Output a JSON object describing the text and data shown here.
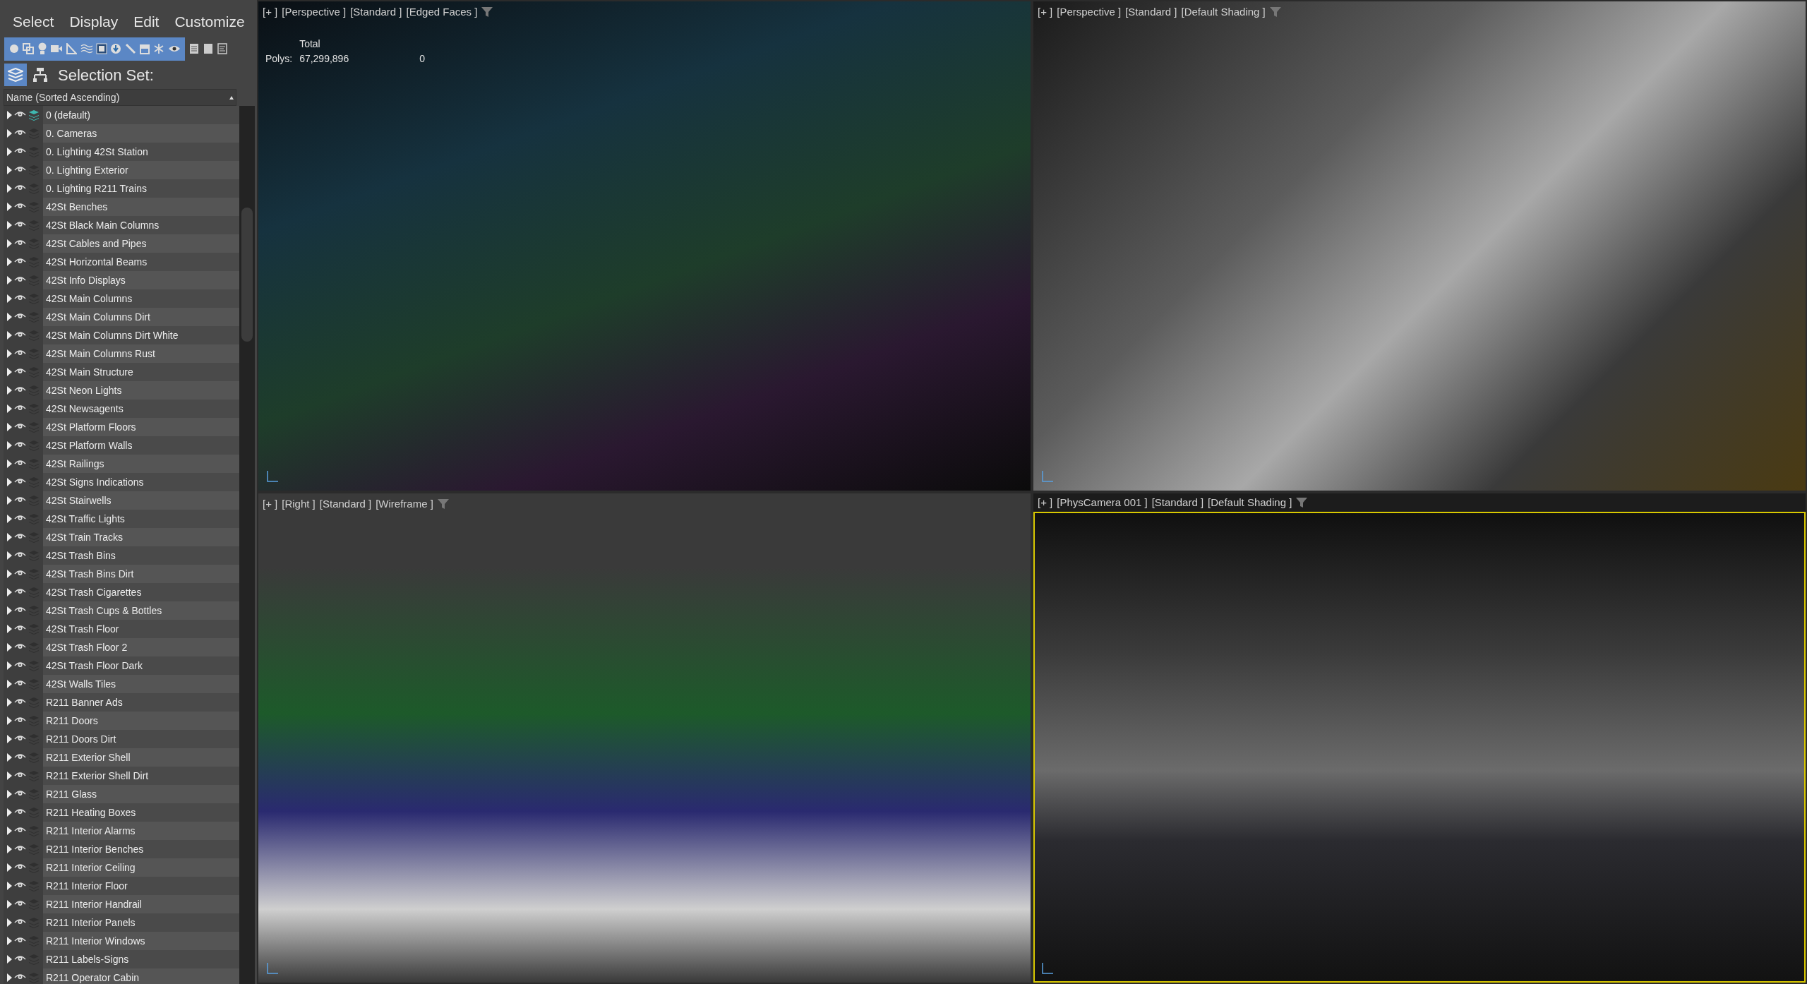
{
  "menu": [
    "Select",
    "Display",
    "Edit",
    "Customize"
  ],
  "selection_set": {
    "label": "Selection Set:"
  },
  "column_header": "Name (Sorted Ascending)",
  "layers": [
    {
      "name": "0 (default)",
      "visible": true,
      "current": true
    },
    {
      "name": "0. Cameras",
      "visible": true,
      "current": false
    },
    {
      "name": "0. Lighting 42St Station",
      "visible": true,
      "current": false
    },
    {
      "name": "0. Lighting Exterior",
      "visible": true,
      "current": false
    },
    {
      "name": "0. Lighting R211 Trains",
      "visible": true,
      "current": false
    },
    {
      "name": "42St Benches",
      "visible": true,
      "current": false
    },
    {
      "name": "42St Black Main Columns",
      "visible": true,
      "current": false
    },
    {
      "name": "42St Cables and Pipes",
      "visible": true,
      "current": false
    },
    {
      "name": "42St Horizontal Beams",
      "visible": true,
      "current": false
    },
    {
      "name": "42St Info Displays",
      "visible": true,
      "current": false
    },
    {
      "name": "42St Main Columns",
      "visible": true,
      "current": false
    },
    {
      "name": "42St Main Columns Dirt",
      "visible": true,
      "current": false
    },
    {
      "name": "42St Main Columns Dirt White",
      "visible": true,
      "current": false
    },
    {
      "name": "42St Main Columns Rust",
      "visible": true,
      "current": false
    },
    {
      "name": "42St Main Structure",
      "visible": true,
      "current": false
    },
    {
      "name": "42St Neon Lights",
      "visible": true,
      "current": false
    },
    {
      "name": "42St Newsagents",
      "visible": true,
      "current": false
    },
    {
      "name": "42St Platform Floors",
      "visible": true,
      "current": false
    },
    {
      "name": "42St Platform Walls",
      "visible": true,
      "current": false
    },
    {
      "name": "42St Railings",
      "visible": true,
      "current": false
    },
    {
      "name": "42St Signs Indications",
      "visible": true,
      "current": false
    },
    {
      "name": "42St Stairwells",
      "visible": true,
      "current": false
    },
    {
      "name": "42St Traffic Lights",
      "visible": true,
      "current": false
    },
    {
      "name": "42St Train Tracks",
      "visible": true,
      "current": false
    },
    {
      "name": "42St Trash Bins",
      "visible": true,
      "current": false
    },
    {
      "name": "42St Trash Bins Dirt",
      "visible": true,
      "current": false
    },
    {
      "name": "42St Trash Cigarettes",
      "visible": true,
      "current": false
    },
    {
      "name": "42St Trash Cups & Bottles",
      "visible": true,
      "current": false
    },
    {
      "name": "42St Trash Floor",
      "visible": true,
      "current": false
    },
    {
      "name": "42St Trash Floor 2",
      "visible": true,
      "current": false
    },
    {
      "name": "42St Trash Floor Dark",
      "visible": true,
      "current": false
    },
    {
      "name": "42St Walls Tiles",
      "visible": true,
      "current": false
    },
    {
      "name": "R211 Banner Ads",
      "visible": true,
      "current": false
    },
    {
      "name": "R211 Doors",
      "visible": true,
      "current": false
    },
    {
      "name": "R211 Doors Dirt",
      "visible": true,
      "current": false
    },
    {
      "name": "R211 Exterior Shell",
      "visible": true,
      "current": false
    },
    {
      "name": "R211 Exterior Shell Dirt",
      "visible": true,
      "current": false
    },
    {
      "name": "R211 Glass",
      "visible": true,
      "current": false
    },
    {
      "name": "R211 Heating Boxes",
      "visible": true,
      "current": false
    },
    {
      "name": "R211 Interior Alarms",
      "visible": true,
      "current": false
    },
    {
      "name": "R211 Interior Benches",
      "visible": true,
      "current": false
    },
    {
      "name": "R211 Interior Ceiling",
      "visible": true,
      "current": false
    },
    {
      "name": "R211 Interior Floor",
      "visible": true,
      "current": false
    },
    {
      "name": "R211 Interior Handrail",
      "visible": true,
      "current": false
    },
    {
      "name": "R211 Interior Panels",
      "visible": true,
      "current": false
    },
    {
      "name": "R211 Interior Windows",
      "visible": true,
      "current": false
    },
    {
      "name": "R211 Labels-Signs",
      "visible": true,
      "current": false
    },
    {
      "name": "R211 Operator Cabin",
      "visible": true,
      "current": false
    }
  ],
  "viewports": [
    {
      "label": [
        "[+ ]",
        "[Perspective ]",
        "[Standard ]",
        "[Edged Faces ]"
      ],
      "active": false,
      "stats": {
        "total": "Total",
        "polys_label": "Polys:",
        "polys_value": "67,299,896",
        "extra": "0"
      }
    },
    {
      "label": [
        "[+ ]",
        "[Perspective ]",
        "[Standard ]",
        "[Default Shading ]"
      ],
      "active": false
    },
    {
      "label": [
        "[+ ]",
        "[Right ]",
        "[Standard ]",
        "[Wireframe ]"
      ],
      "active": false
    },
    {
      "label": [
        "[+ ]",
        "[PhysCamera 001 ]",
        "[Standard ]",
        "[Default Shading ]"
      ],
      "active": true
    }
  ]
}
